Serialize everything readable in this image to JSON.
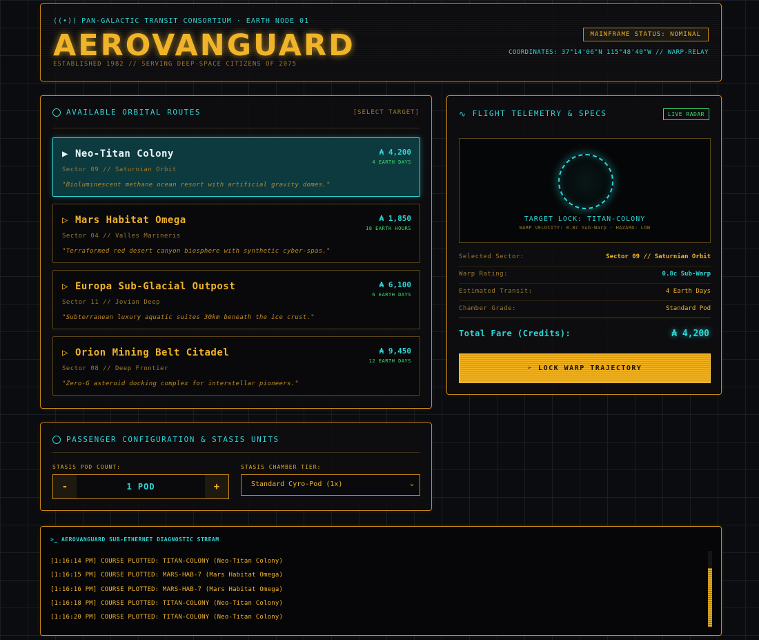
{
  "header": {
    "subtitle": "PAN-GALACTIC TRANSIT CONSORTIUM · EARTH NODE 01",
    "title": "AEROVANGUARD",
    "established": "ESTABLISHED 1982 // SERVING DEEP-SPACE CITIZENS OF 2075",
    "mainframe_status": "MAINFRAME STATUS: NOMINAL",
    "coordinates": "COORDINATES: 37°14'06\"N 115°48'40\"W // WARP-RELAY"
  },
  "routes": {
    "heading": "AVAILABLE ORBITAL ROUTES",
    "select_hint": "[SELECT TARGET]",
    "items": [
      {
        "name": "Neo-Titan Colony",
        "sector": "Sector 09 // Saturnian Orbit",
        "description": "\"Bioluminescent methane ocean resort with artificial gravity domes.\"",
        "price": "₳ 4,200",
        "duration": "4 EARTH DAYS",
        "active": true
      },
      {
        "name": "Mars Habitat Omega",
        "sector": "Sector 04 // Valles Marineris",
        "description": "\"Terraformed red desert canyon biosphere with synthetic cyber-spas.\"",
        "price": "₳ 1,850",
        "duration": "18 EARTH HOURS",
        "active": false
      },
      {
        "name": "Europa Sub-Glacial Outpost",
        "sector": "Sector 11 // Jovian Deep",
        "description": "\"Subterranean luxury aquatic suites 30km beneath the ice crust.\"",
        "price": "₳ 6,100",
        "duration": "6 EARTH DAYS",
        "active": false
      },
      {
        "name": "Orion Mining Belt Citadel",
        "sector": "Sector 08 // Deep Frontier",
        "description": "\"Zero-G asteroid docking complex for interstellar pioneers.\"",
        "price": "₳ 9,450",
        "duration": "12 EARTH DAYS",
        "active": false
      }
    ]
  },
  "telemetry": {
    "heading": "FLIGHT TELEMETRY & SPECS",
    "live_badge": "LIVE RADAR",
    "target_lock": "TARGET LOCK: TITAN-COLONY",
    "warp_info": "WARP VELOCITY: 0.8c Sub-Warp · HAZARD: LOW",
    "specs": [
      {
        "label": "Selected Sector:",
        "value": "Sector 09 // Saturnian Orbit"
      },
      {
        "label": "Warp Rating:",
        "value": "0.8c Sub-Warp"
      },
      {
        "label": "Estimated Transit:",
        "value": "4 Earth Days"
      },
      {
        "label": "Chamber Grade:",
        "value": "Standard Pod"
      }
    ],
    "total_label": "Total Fare (Credits):",
    "total_value": "₳ 4,200",
    "lock_button": "LOCK WARP TRAJECTORY"
  },
  "passenger": {
    "heading": "PASSENGER CONFIGURATION & STASIS UNITS",
    "pod_count_label": "STASIS POD COUNT:",
    "minus": "-",
    "plus": "+",
    "pod_count_value": "1 POD",
    "tier_label": "STASIS CHAMBER TIER:",
    "tier_value": "Standard Cyro-Pod (1x)"
  },
  "console": {
    "heading": ">_  AEROVANGUARD SUB-ETHERNET DIAGNOSTIC STREAM",
    "logs": [
      "[1:16:14 PM] COURSE PLOTTED: TITAN-COLONY (Neo-Titan Colony)",
      "[1:16:15 PM] COURSE PLOTTED: MARS-HAB-7 (Mars Habitat Omega)",
      "[1:16:16 PM] COURSE PLOTTED: MARS-HAB-7 (Mars Habitat Omega)",
      "[1:16:18 PM] COURSE PLOTTED: TITAN-COLONY (Neo-Titan Colony)",
      "[1:16:20 PM] COURSE PLOTTED: TITAN-COLONY (Neo-Titan Colony)"
    ]
  }
}
